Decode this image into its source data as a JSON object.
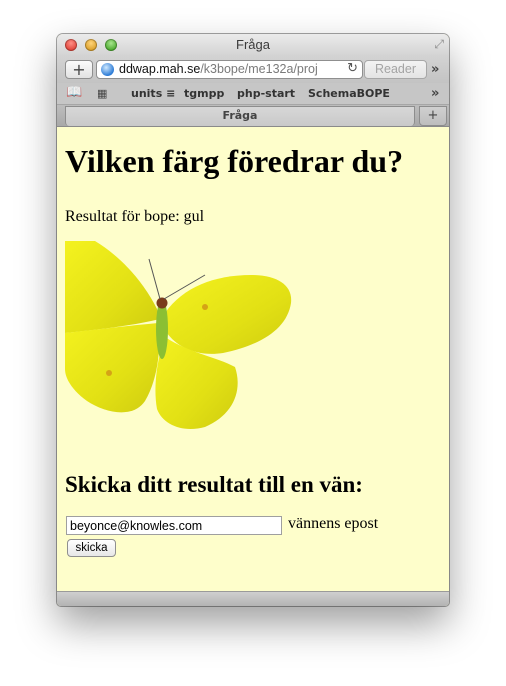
{
  "window": {
    "title": "Fråga"
  },
  "toolbar": {
    "add_label": "+",
    "url_domain": "ddwap.mah.se",
    "url_path": "/k3bope/me132a/proj",
    "reader_label": "Reader",
    "reload_icon": "reload-icon"
  },
  "bookmarks": {
    "items": [
      {
        "label": "units ≡"
      },
      {
        "label": "tgmpp"
      },
      {
        "label": "php-start"
      },
      {
        "label": "SchemaBOPE"
      }
    ]
  },
  "tabs": [
    {
      "label": "Fråga"
    }
  ],
  "page": {
    "heading": "Vilken färg föredrar du?",
    "result_text": "Resultat för bope: gul",
    "send_heading": "Skicka ditt resultat till en vän:",
    "email_value": "beyonce@knowles.com",
    "email_label": "vännens epost",
    "submit_label": "skicka"
  },
  "colors": {
    "page_background": "#fefecb",
    "butterfly_yellow": "#e7e61a"
  }
}
